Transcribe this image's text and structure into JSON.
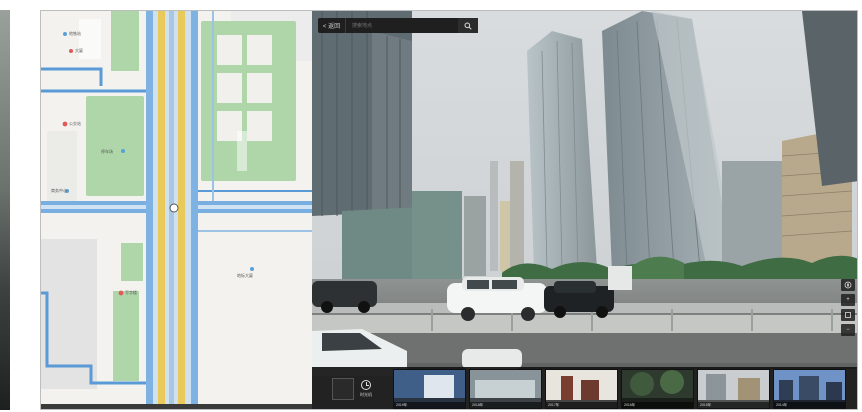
{
  "search": {
    "back_label": "< 返回",
    "query": "搜索地点"
  },
  "map": {
    "poi_labels": [
      "地铁站",
      "大厦",
      "公交站",
      "停车场",
      "写字楼",
      "商务中心",
      "地标大厦"
    ]
  },
  "filmstrip": {
    "time_label": "时光机",
    "thumbnails": [
      {
        "caption": "2019年"
      },
      {
        "caption": "2018年"
      },
      {
        "caption": "2017年"
      },
      {
        "caption": "2016年"
      },
      {
        "caption": "2015年"
      },
      {
        "caption": "2014年"
      }
    ]
  },
  "colors": {
    "road_blue": "#6fa8dc",
    "road_yellow": "#e8c84a",
    "park_green": "#a9d3a5",
    "sky": "#d5d9db",
    "toolbar": "#1f1f1f"
  }
}
